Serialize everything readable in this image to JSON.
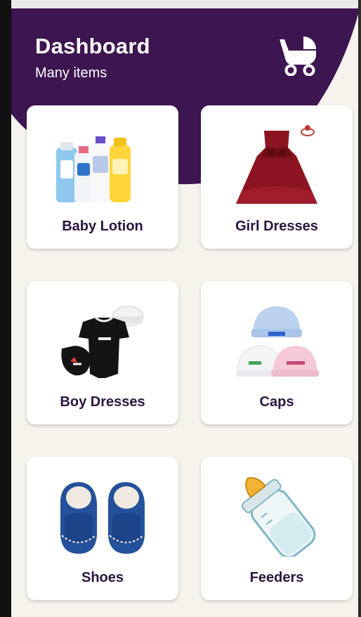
{
  "header": {
    "title": "Dashboard",
    "subtitle": "Many items",
    "bg_color": "#3d1550",
    "icon": "baby-stroller-icon"
  },
  "categories": [
    {
      "label": "Baby Lotion",
      "icon": "lotion-bottles-icon"
    },
    {
      "label": "Girl Dresses",
      "icon": "girl-dress-icon"
    },
    {
      "label": "Boy Dresses",
      "icon": "onesie-icon"
    },
    {
      "label": "Caps",
      "icon": "baby-caps-icon"
    },
    {
      "label": "Shoes",
      "icon": "baby-shoes-icon"
    },
    {
      "label": "Feeders",
      "icon": "feeding-bottle-icon"
    }
  ],
  "colors": {
    "background": "#f6f3ec",
    "card": "#ffffff",
    "label": "#2b1540"
  }
}
